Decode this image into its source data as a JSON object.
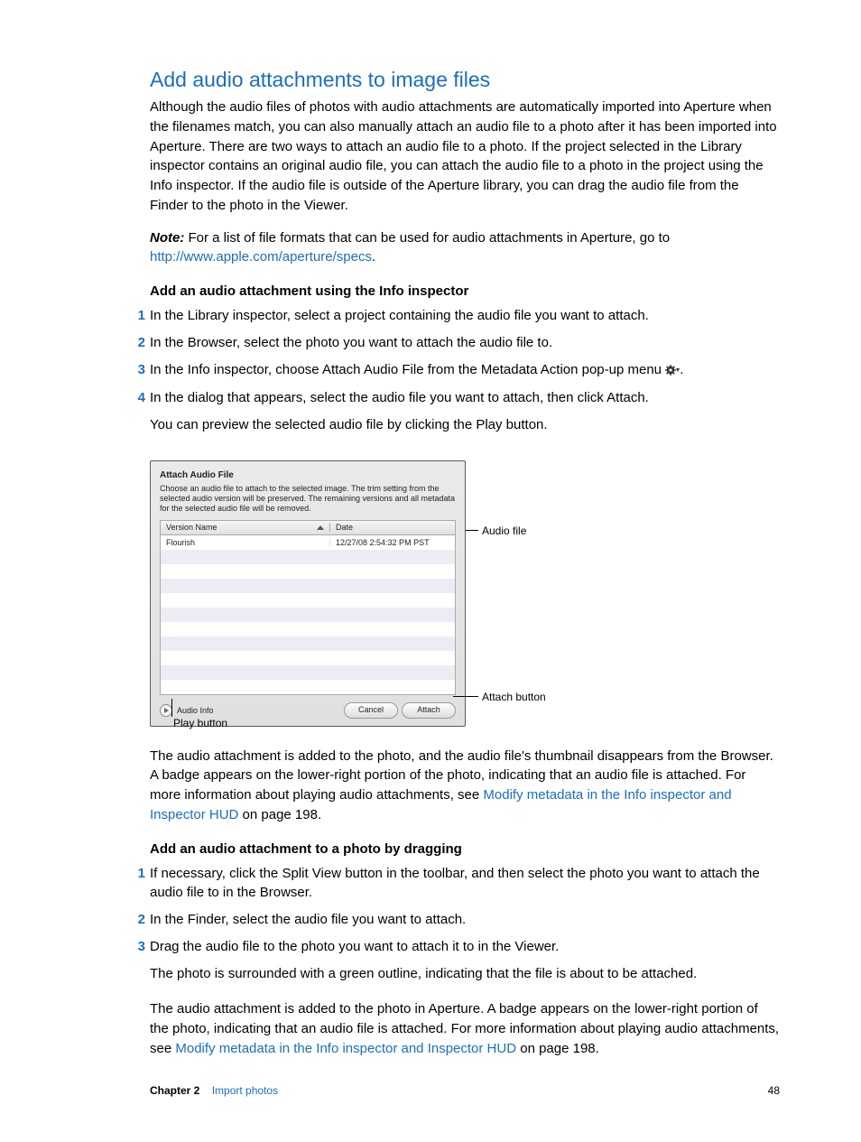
{
  "title": "Add audio attachments to image files",
  "intro": "Although the audio files of photos with audio attachments are automatically imported into Aperture when the filenames match, you can also manually attach an audio file to a photo after it has been imported into Aperture. There are two ways to attach an audio file to a photo. If the project selected in the Library inspector contains an original audio file, you can attach the audio file to a photo in the project using the Info inspector. If the audio file is outside of the Aperture library, you can drag the audio file from the Finder to the photo in the Viewer.",
  "note": {
    "label": "Note:",
    "body_a": "  For a list of file formats that can be used for audio attachments in Aperture, go to ",
    "link": "http://www.apple.com/aperture/specs",
    "body_b": "."
  },
  "section_a": {
    "heading": "Add an audio attachment using the Info inspector",
    "steps": {
      "s1": "In the Library inspector, select a project containing the audio file you want to attach.",
      "s2": "In the Browser, select the photo you want to attach the audio file to.",
      "s3_pre": "In the Info inspector, choose Attach Audio File from the Metadata Action pop-up menu ",
      "s3_post": ".",
      "s4": "In the dialog that appears, select the audio file you want to attach, then click Attach.",
      "s4_after": "You can preview the selected audio file by clicking the Play button."
    }
  },
  "dialog": {
    "title": "Attach Audio File",
    "description": "Choose an audio file to attach to the selected image. The trim setting from the selected audio version will be preserved. The remaining versions and all metadata for the selected audio file will be removed.",
    "col_version": "Version Name",
    "col_date": "Date",
    "row1_name": "Flourish",
    "row1_date": "12/27/08 2:54:32 PM PST",
    "audio_info": "Audio Info",
    "cancel": "Cancel",
    "attach": "Attach",
    "callout_audio_file": "Audio file",
    "callout_attach": "Attach button",
    "callout_play": "Play button"
  },
  "outcome_a": {
    "pre": "The audio attachment is added to the photo, and the audio file's thumbnail disappears from the Browser. A badge appears on the lower-right portion of the photo, indicating that an audio file is attached. For more information about playing audio attachments, see ",
    "link": "Modify metadata in the Info inspector and Inspector HUD",
    "post": " on page 198."
  },
  "section_b": {
    "heading": "Add an audio attachment to a photo by dragging",
    "steps": {
      "s1": "If necessary, click the Split View button in the toolbar, and then select the photo you want to attach the audio file to in the Browser.",
      "s2": "In the Finder, select the audio file you want to attach.",
      "s3": "Drag the audio file to the photo you want to attach it to in the Viewer.",
      "s3_after": "The photo is surrounded with a green outline, indicating that the file is about to be attached."
    }
  },
  "outcome_b": {
    "pre": "The audio attachment is added to the photo in Aperture. A badge appears on the lower-right portion of the photo, indicating that an audio file is attached. For more information about playing audio attachments, see ",
    "link": "Modify metadata in the Info inspector and Inspector HUD",
    "post": " on page 198."
  },
  "footer": {
    "chapter_label": "Chapter 2",
    "chapter_name": "Import photos",
    "page": "48"
  },
  "list_numbers": {
    "n1": "1",
    "n2": "2",
    "n3": "3",
    "n4": "4"
  }
}
